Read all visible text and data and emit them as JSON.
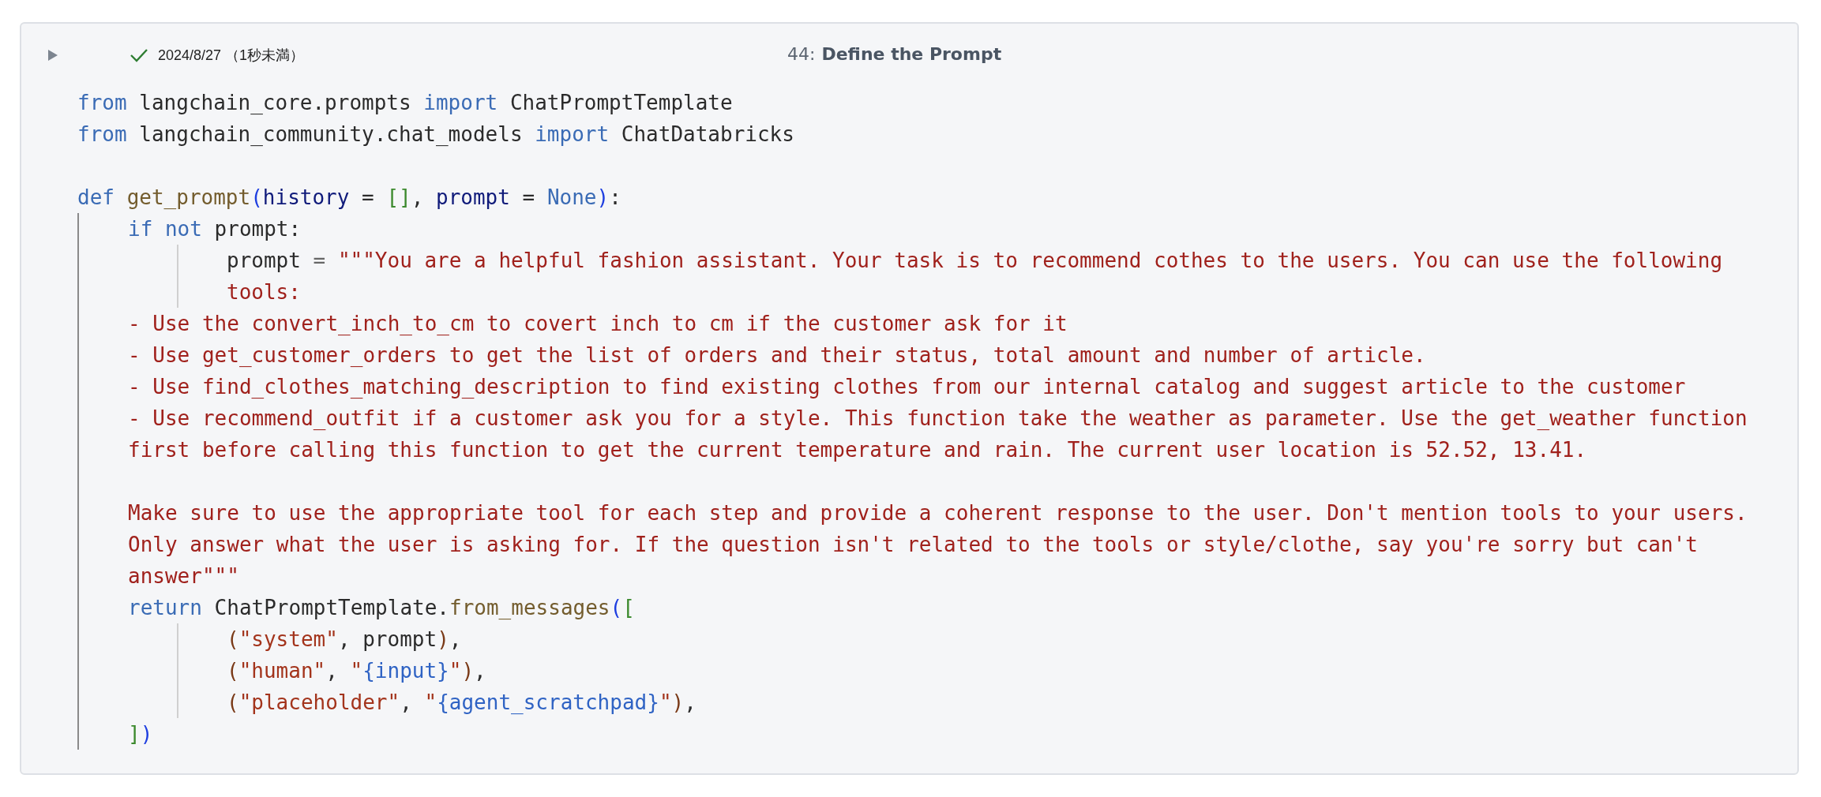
{
  "cell": {
    "succeeded": true,
    "timestamp": "2024/8/27 （1秒未満）",
    "number": "44:",
    "title": "Define the Prompt",
    "code": [
      {
        "kind": "code",
        "tokens": [
          {
            "text": "from ",
            "kind": "keyword"
          },
          {
            "text": "langchain_core.prompts ",
            "kind": "plain"
          },
          {
            "text": "import ",
            "kind": "keyword"
          },
          {
            "text": "ChatPromptTemplate",
            "kind": "plain"
          }
        ]
      },
      {
        "kind": "code",
        "tokens": [
          {
            "text": "from ",
            "kind": "keyword"
          },
          {
            "text": "langchain_community.chat_models ",
            "kind": "plain"
          },
          {
            "text": "import ",
            "kind": "keyword"
          },
          {
            "text": "ChatDatabricks",
            "kind": "plain"
          }
        ]
      },
      {
        "kind": "blank"
      },
      {
        "kind": "code",
        "tokens": [
          {
            "text": "def ",
            "kind": "keyword"
          },
          {
            "text": "get_prompt",
            "kind": "function"
          },
          {
            "text": "(",
            "kind": "bracket"
          },
          {
            "text": "history",
            "kind": "param"
          },
          {
            "text": " = ",
            "kind": "plain"
          },
          {
            "text": "[]",
            "kind": "bracket2"
          },
          {
            "text": ", ",
            "kind": "plain"
          },
          {
            "text": "prompt",
            "kind": "param"
          },
          {
            "text": " = ",
            "kind": "plain"
          },
          {
            "text": "None",
            "kind": "keyword"
          },
          {
            "text": ")",
            "kind": "bracket"
          },
          {
            "text": ":",
            "kind": "plain"
          }
        ],
        "children": [
          {
            "kind": "code",
            "tokens": [
              {
                "text": "if not ",
                "kind": "keyword"
              },
              {
                "text": "prompt:",
                "kind": "plain"
              }
            ],
            "children": [
              {
                "kind": "code",
                "tokens": [
                  {
                    "text": "prompt ",
                    "kind": "plain"
                  },
                  {
                    "text": "= ",
                    "kind": "operator"
                  },
                  {
                    "text": "\"\"\"You are a helpful fashion assistant. Your task is to recommend cothes to the users. You can use the following",
                    "kind": "string"
                  }
                ]
              },
              {
                "kind": "code",
                "tokens": [
                  {
                    "text": "tools:",
                    "kind": "string"
                  }
                ]
              }
            ]
          },
          {
            "kind": "code",
            "tokens": [
              {
                "text": "- Use the convert_inch_to_cm to covert inch to cm if the customer ask for it",
                "kind": "string"
              }
            ]
          },
          {
            "kind": "code",
            "tokens": [
              {
                "text": "- Use get_customer_orders to get the list of orders and their status, total amount and number of article.",
                "kind": "string"
              }
            ]
          },
          {
            "kind": "code",
            "tokens": [
              {
                "text": "- Use find_clothes_matching_description to find existing clothes from our internal catalog and suggest article to the customer",
                "kind": "string"
              }
            ]
          },
          {
            "kind": "code",
            "tokens": [
              {
                "text": "- Use recommend_outfit if a customer ask you for a style. This function take the weather as parameter. Use the get_weather function",
                "kind": "string"
              }
            ]
          },
          {
            "kind": "code",
            "tokens": [
              {
                "text": "first before calling this function to get the current temperature and rain. The current user location is 52.52, 13.41.",
                "kind": "string"
              }
            ]
          },
          {
            "kind": "blank"
          },
          {
            "kind": "code",
            "tokens": [
              {
                "text": "Make sure to use the appropriate tool for each step and provide a coherent response to the user. Don't mention tools to your users.",
                "kind": "string"
              }
            ]
          },
          {
            "kind": "code",
            "tokens": [
              {
                "text": "Only answer what the user is asking for. If the question isn't related to the tools or style/clothe, say you're sorry but can't",
                "kind": "string"
              }
            ]
          },
          {
            "kind": "code",
            "tokens": [
              {
                "text": "answer\"\"\"",
                "kind": "string"
              }
            ]
          },
          {
            "kind": "code",
            "tokens": [
              {
                "text": "return ",
                "kind": "keyword"
              },
              {
                "text": "ChatPromptTemplate.",
                "kind": "plain"
              },
              {
                "text": "from_messages",
                "kind": "function"
              },
              {
                "text": "(",
                "kind": "bracket"
              },
              {
                "text": "[",
                "kind": "bracket2"
              }
            ],
            "children": [
              {
                "kind": "code",
                "tokens": [
                  {
                    "text": "(",
                    "kind": "paren"
                  },
                  {
                    "text": "\"system\"",
                    "kind": "string2"
                  },
                  {
                    "text": ", prompt",
                    "kind": "plain"
                  },
                  {
                    "text": ")",
                    "kind": "paren"
                  },
                  {
                    "text": ",",
                    "kind": "plain"
                  }
                ]
              },
              {
                "kind": "code",
                "tokens": [
                  {
                    "text": "(",
                    "kind": "paren"
                  },
                  {
                    "text": "\"human\"",
                    "kind": "string2"
                  },
                  {
                    "text": ", ",
                    "kind": "plain"
                  },
                  {
                    "text": "\"",
                    "kind": "string2"
                  },
                  {
                    "text": "{input}",
                    "kind": "interp"
                  },
                  {
                    "text": "\"",
                    "kind": "string2"
                  },
                  {
                    "text": ")",
                    "kind": "paren"
                  },
                  {
                    "text": ",",
                    "kind": "plain"
                  }
                ]
              },
              {
                "kind": "code",
                "tokens": [
                  {
                    "text": "(",
                    "kind": "paren"
                  },
                  {
                    "text": "\"placeholder\"",
                    "kind": "string2"
                  },
                  {
                    "text": ", ",
                    "kind": "plain"
                  },
                  {
                    "text": "\"",
                    "kind": "string2"
                  },
                  {
                    "text": "{agent_scratchpad}",
                    "kind": "interp"
                  },
                  {
                    "text": "\"",
                    "kind": "string2"
                  },
                  {
                    "text": ")",
                    "kind": "paren"
                  },
                  {
                    "text": ",",
                    "kind": "plain"
                  }
                ]
              }
            ]
          },
          {
            "kind": "code",
            "tokens": [
              {
                "text": "]",
                "kind": "bracket2"
              },
              {
                "text": ")",
                "kind": "bracket"
              }
            ]
          }
        ]
      }
    ]
  }
}
